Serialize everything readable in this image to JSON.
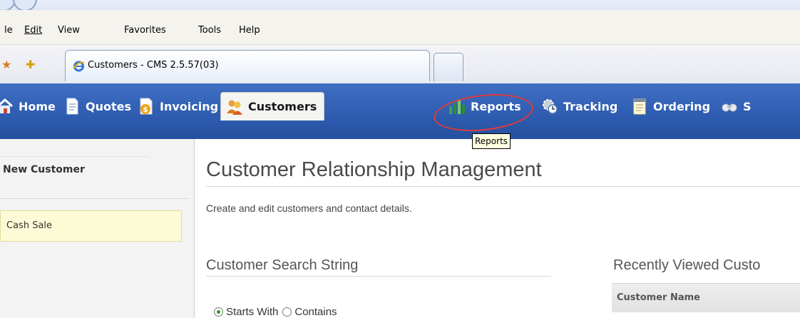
{
  "browser": {
    "menu": [
      {
        "label": "le",
        "left": 0
      },
      {
        "label": "Edit"
      },
      {
        "label": "View"
      },
      {
        "label": "Favorites"
      },
      {
        "label": "Tools"
      },
      {
        "label": "Help"
      }
    ],
    "tab": {
      "title": "Customers - CMS 2.5.57(03)"
    }
  },
  "nav": {
    "items": [
      {
        "label": "Home",
        "icon": "home-icon"
      },
      {
        "label": "Quotes",
        "icon": "document-icon"
      },
      {
        "label": "Invoicing",
        "icon": "invoice-icon"
      },
      {
        "label": "Customers",
        "icon": "people-icon",
        "active": true
      },
      {
        "label": "Reports",
        "icon": "bar-chart-icon"
      },
      {
        "label": "Tracking",
        "icon": "gear-clock-icon"
      },
      {
        "label": "Ordering",
        "icon": "notepad-icon"
      },
      {
        "label": "S",
        "icon": "binoculars-icon"
      }
    ],
    "tooltip": "Reports"
  },
  "sidebar": {
    "new_customer": "New Customer",
    "cash_sale": "Cash Sale"
  },
  "main": {
    "title": "Customer Relationship Management",
    "subtitle": "Create and edit customers and contact details.",
    "search": {
      "heading": "Customer Search String",
      "options": [
        {
          "label": "Starts With",
          "checked": true
        },
        {
          "label": "Contains",
          "checked": false
        }
      ]
    },
    "recent": {
      "heading": "Recently Viewed Custo",
      "column_header": "Customer Name"
    }
  },
  "colors": {
    "nav_background": "#2f5db1",
    "highlight_circle": "#e13a3a",
    "cash_sale_background": "#fdfbd5"
  }
}
